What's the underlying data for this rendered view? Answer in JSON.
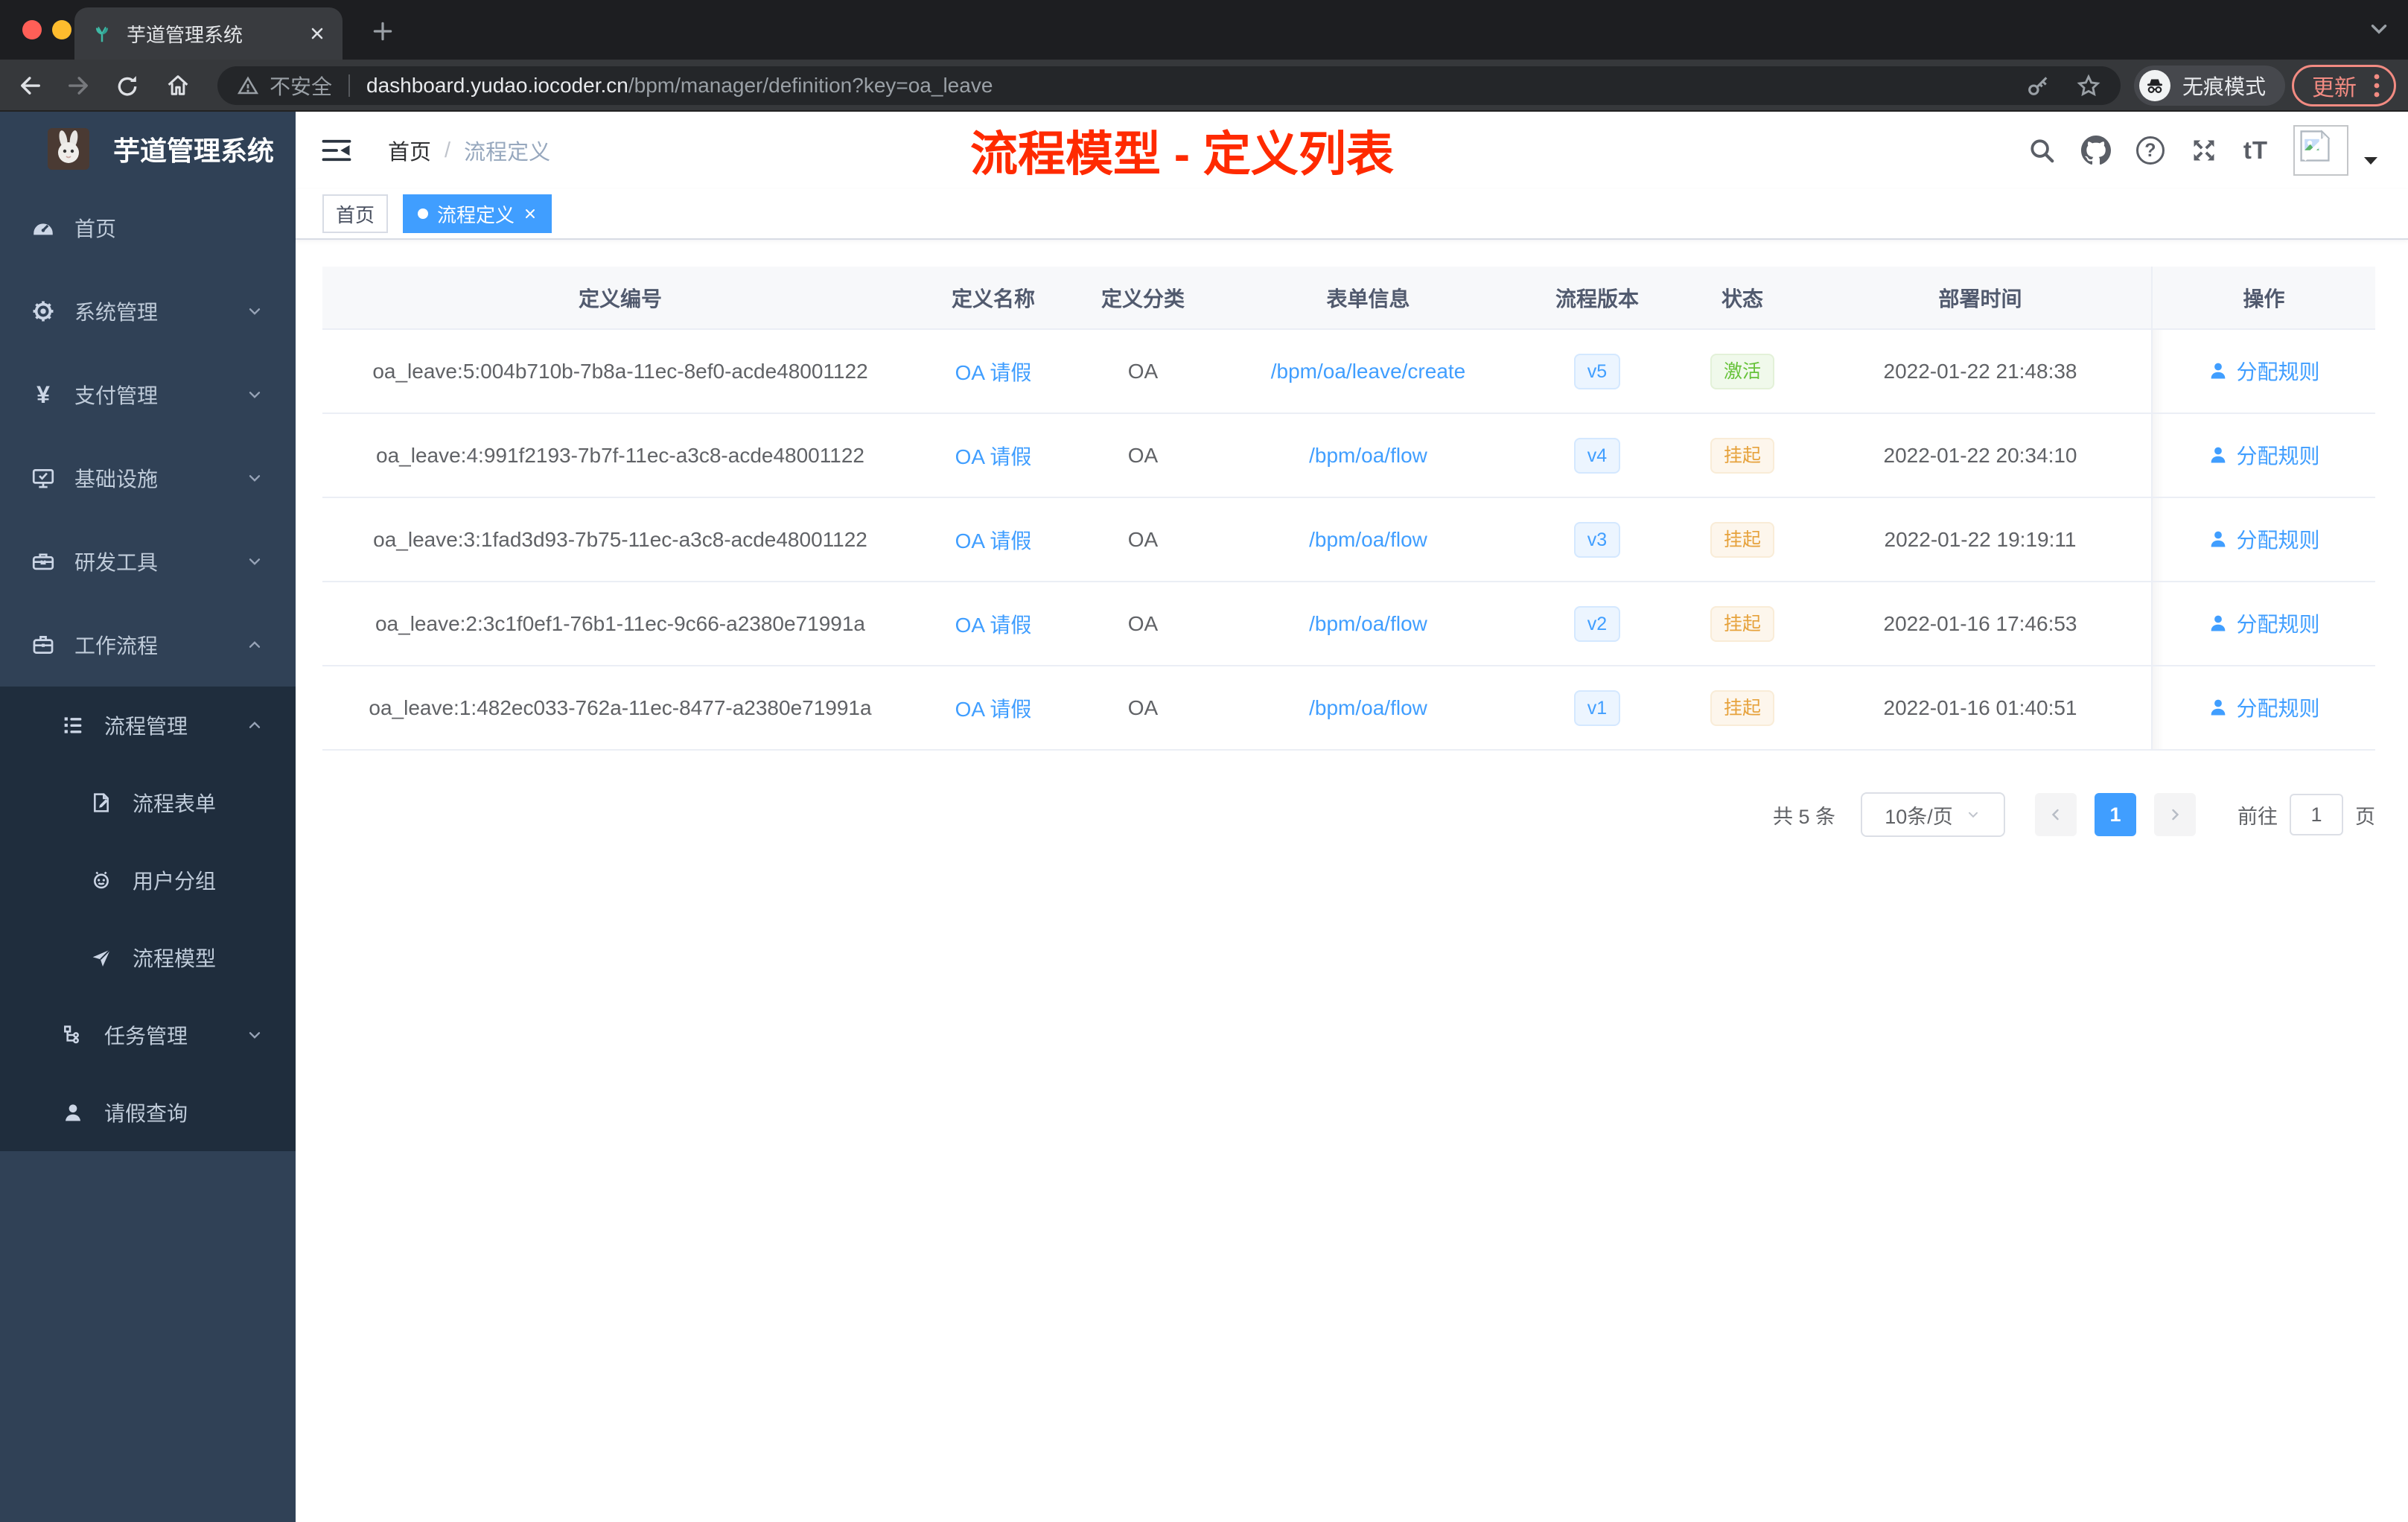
{
  "browser": {
    "tab_title": "芋道管理系统",
    "insecure_label": "不安全",
    "url_host": "dashboard.yudao.iocoder.cn",
    "url_path": "/bpm/manager/definition?key=oa_leave",
    "incognito_label": "无痕模式",
    "update_label": "更新"
  },
  "icons": {
    "yen": "¥",
    "help": "?",
    "font_size": "tT"
  },
  "sidebar": {
    "logo_title": "芋道管理系统",
    "items": [
      {
        "label": "首页",
        "chevron": ""
      },
      {
        "label": "系统管理",
        "chevron": "down"
      },
      {
        "label": "支付管理",
        "chevron": "down"
      },
      {
        "label": "基础设施",
        "chevron": "down"
      },
      {
        "label": "研发工具",
        "chevron": "down"
      },
      {
        "label": "工作流程",
        "chevron": "up"
      },
      {
        "label": "流程管理",
        "chevron": "up"
      },
      {
        "label": "流程表单",
        "chevron": ""
      },
      {
        "label": "用户分组",
        "chevron": ""
      },
      {
        "label": "流程模型",
        "chevron": ""
      },
      {
        "label": "任务管理",
        "chevron": "down"
      },
      {
        "label": "请假查询",
        "chevron": ""
      }
    ]
  },
  "header": {
    "breadcrumb_home": "首页",
    "breadcrumb_separator": "/",
    "breadcrumb_current": "流程定义",
    "annotation": "流程模型 - 定义列表"
  },
  "tags": {
    "items": [
      {
        "label": "首页",
        "state": ""
      },
      {
        "label": "流程定义",
        "state": "active"
      }
    ]
  },
  "table": {
    "columns": [
      "定义编号",
      "定义名称",
      "定义分类",
      "表单信息",
      "流程版本",
      "状态",
      "部署时间",
      "操作"
    ],
    "action_label": "分配规则",
    "rows": [
      {
        "id": "oa_leave:5:004b710b-7b8a-11ec-8ef0-acde48001122",
        "name": "OA 请假",
        "category": "OA",
        "form": "/bpm/oa/leave/create",
        "version": "v5",
        "status": "激活",
        "status_type": "success",
        "deploy_time": "2022-01-22 21:48:38"
      },
      {
        "id": "oa_leave:4:991f2193-7b7f-11ec-a3c8-acde48001122",
        "name": "OA 请假",
        "category": "OA",
        "form": "/bpm/oa/flow",
        "version": "v4",
        "status": "挂起",
        "status_type": "warning",
        "deploy_time": "2022-01-22 20:34:10"
      },
      {
        "id": "oa_leave:3:1fad3d93-7b75-11ec-a3c8-acde48001122",
        "name": "OA 请假",
        "category": "OA",
        "form": "/bpm/oa/flow",
        "version": "v3",
        "status": "挂起",
        "status_type": "warning",
        "deploy_time": "2022-01-22 19:19:11"
      },
      {
        "id": "oa_leave:2:3c1f0ef1-76b1-11ec-9c66-a2380e71991a",
        "name": "OA 请假",
        "category": "OA",
        "form": "/bpm/oa/flow",
        "version": "v2",
        "status": "挂起",
        "status_type": "warning",
        "deploy_time": "2022-01-16 17:46:53"
      },
      {
        "id": "oa_leave:1:482ec033-762a-11ec-8477-a2380e71991a",
        "name": "OA 请假",
        "category": "OA",
        "form": "/bpm/oa/flow",
        "version": "v1",
        "status": "挂起",
        "status_type": "warning",
        "deploy_time": "2022-01-16 01:40:51"
      }
    ]
  },
  "pagination": {
    "total": "共 5 条",
    "page_size": "10条/页",
    "current_page": "1",
    "goto_label": "前往",
    "goto_value": "1",
    "unit_label": "页"
  },
  "colors": {
    "primary": "#409eff",
    "success": "#67c23a",
    "warning": "#e6a23c",
    "annotation_red": "#ff2a00",
    "sidebar_bg": "#304156",
    "submenu_bg": "#1f2d3d",
    "update_pill": "#f28b82"
  }
}
